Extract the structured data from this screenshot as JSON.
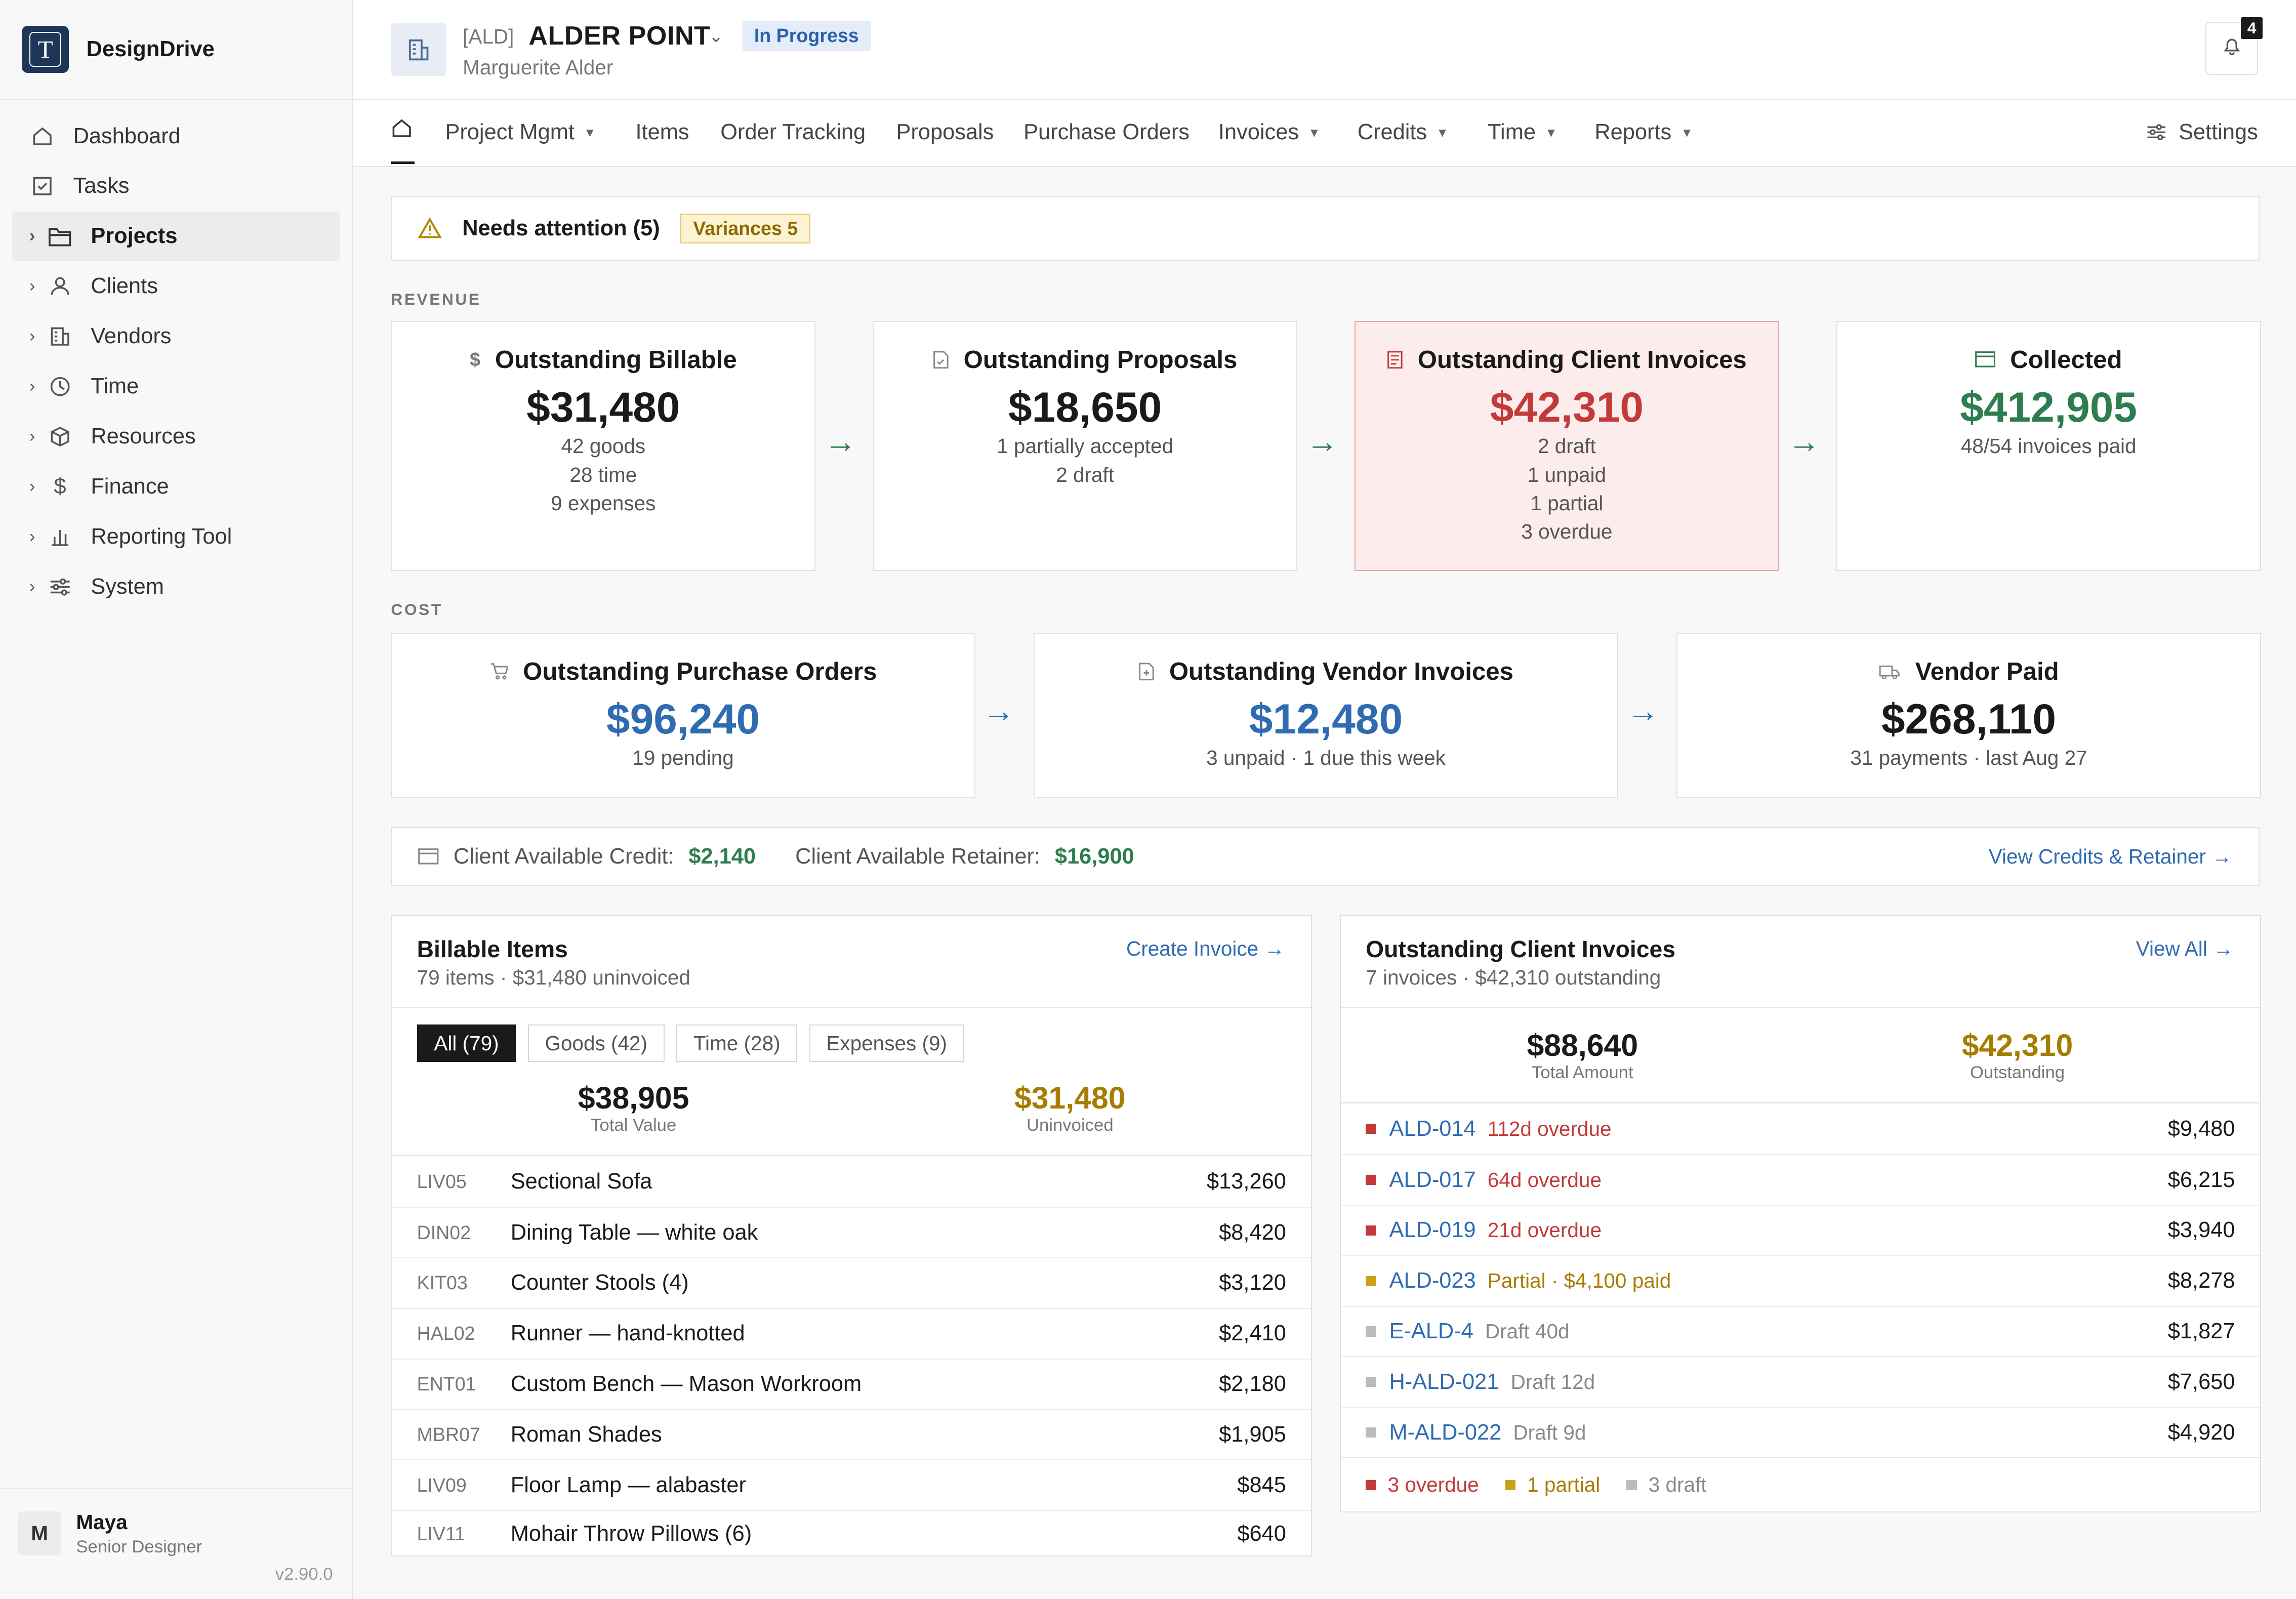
{
  "app": {
    "name": "DesignDrive",
    "logo_letter": "T",
    "version": "v2.90.0"
  },
  "sidebar": {
    "items": [
      {
        "label": "Dashboard",
        "icon": "home-icon"
      },
      {
        "label": "Tasks",
        "icon": "checkbox-icon"
      },
      {
        "label": "Projects",
        "icon": "folder-icon",
        "active": true
      },
      {
        "label": "Clients",
        "icon": "user-icon"
      },
      {
        "label": "Vendors",
        "icon": "building-icon"
      },
      {
        "label": "Time",
        "icon": "clock-icon"
      },
      {
        "label": "Resources",
        "icon": "box-icon"
      },
      {
        "label": "Finance",
        "icon": "dollar-icon"
      },
      {
        "label": "Reporting Tool",
        "icon": "bar-chart-icon"
      },
      {
        "label": "System",
        "icon": "sliders-icon"
      }
    ]
  },
  "user": {
    "initial": "M",
    "name": "Maya",
    "role": "Senior Designer"
  },
  "project": {
    "code": "[ALD]",
    "name": "ALDER POINT",
    "status": "In Progress",
    "client": "Marguerite Alder"
  },
  "notifications": {
    "count": "4"
  },
  "tabs": [
    "Project Mgmt",
    "Items",
    "Order Tracking",
    "Proposals",
    "Purchase Orders",
    "Invoices",
    "Credits",
    "Time",
    "Reports"
  ],
  "settings_label": "Settings",
  "attention": {
    "title": "Needs attention (5)",
    "badge": "Variances 5"
  },
  "revenue": {
    "label": "REVENUE",
    "cards": [
      {
        "title": "Outstanding Billable",
        "icon": "dollar-icon",
        "value": "$31,480",
        "lines": [
          "42 goods",
          "28 time",
          "9 expenses"
        ]
      },
      {
        "title": "Outstanding Proposals",
        "icon": "document-check-icon",
        "value": "$18,650",
        "lines": [
          "1 partially accepted",
          "2 draft"
        ]
      },
      {
        "title": "Outstanding Client Invoices",
        "icon": "invoice-icon",
        "value": "$42,310",
        "lines": [
          "2 draft",
          "1 unpaid",
          "1 partial",
          "3 overdue"
        ]
      },
      {
        "title": "Collected",
        "icon": "card-icon",
        "value": "$412,905",
        "lines": [
          "48/54 invoices paid"
        ]
      }
    ]
  },
  "cost": {
    "label": "COST",
    "cards": [
      {
        "title": "Outstanding Purchase Orders",
        "icon": "cart-icon",
        "value": "$96,240",
        "lines": [
          "19 pending"
        ]
      },
      {
        "title": "Outstanding Vendor Invoices",
        "icon": "document-icon",
        "value": "$12,480",
        "lines": [
          "3 unpaid · 1 due this week"
        ]
      },
      {
        "title": "Vendor Paid",
        "icon": "truck-icon",
        "value": "$268,110",
        "lines": [
          "31 payments · last Aug 27"
        ]
      }
    ]
  },
  "credit": {
    "credit_label": "Client Available Credit:",
    "credit_value": "$2,140",
    "retainer_label": "Client Available Retainer:",
    "retainer_value": "$16,900",
    "link": "View Credits & Retainer"
  },
  "billable": {
    "title": "Billable Items",
    "subtitle": "79 items · $31,480 uninvoiced",
    "link": "Create Invoice",
    "filters": [
      "All (79)",
      "Goods (42)",
      "Time (28)",
      "Expenses (9)"
    ],
    "total_value": "$38,905",
    "total_label": "Total Value",
    "uninvoiced_value": "$31,480",
    "uninvoiced_label": "Uninvoiced",
    "rows": [
      {
        "code": "LIV05",
        "name": "Sectional Sofa",
        "amount": "$13,260"
      },
      {
        "code": "DIN02",
        "name": "Dining Table — white oak",
        "amount": "$8,420"
      },
      {
        "code": "KIT03",
        "name": "Counter Stools (4)",
        "amount": "$3,120"
      },
      {
        "code": "HAL02",
        "name": "Runner — hand-knotted",
        "amount": "$2,410"
      },
      {
        "code": "ENT01",
        "name": "Custom Bench — Mason Workroom",
        "amount": "$2,180"
      },
      {
        "code": "MBR07",
        "name": "Roman Shades",
        "amount": "$1,905"
      },
      {
        "code": "LIV09",
        "name": "Floor Lamp — alabaster",
        "amount": "$845"
      },
      {
        "code": "LIV11",
        "name": "Mohair Throw Pillows (6)",
        "amount": "$640"
      }
    ]
  },
  "invoices": {
    "title": "Outstanding Client Invoices",
    "subtitle": "7 invoices · $42,310 outstanding",
    "link": "View All",
    "total_value": "$88,640",
    "total_label": "Total Amount",
    "outstanding_value": "$42,310",
    "outstanding_label": "Outstanding",
    "rows": [
      {
        "id": "ALD-014",
        "note": "112d overdue",
        "amount": "$9,480",
        "status": "overdue"
      },
      {
        "id": "ALD-017",
        "note": "64d overdue",
        "amount": "$6,215",
        "status": "overdue"
      },
      {
        "id": "ALD-019",
        "note": "21d overdue",
        "amount": "$3,940",
        "status": "overdue"
      },
      {
        "id": "ALD-023",
        "note": "Partial · $4,100 paid",
        "amount": "$8,278",
        "status": "partial"
      },
      {
        "id": "E-ALD-4",
        "note": "Draft 40d",
        "amount": "$1,827",
        "status": "draft"
      },
      {
        "id": "H-ALD-021",
        "note": "Draft 12d",
        "amount": "$7,650",
        "status": "draft"
      },
      {
        "id": "M-ALD-022",
        "note": "Draft 9d",
        "amount": "$4,920",
        "status": "draft"
      }
    ],
    "legend": [
      "3 overdue",
      "1 partial",
      "3 draft"
    ]
  },
  "colors": {
    "overdue": "#c23a3a",
    "partial": "#c9a11a",
    "draft": "#bbbbbb",
    "accent": "#2f6bb0",
    "positive": "#2e7d4e"
  }
}
